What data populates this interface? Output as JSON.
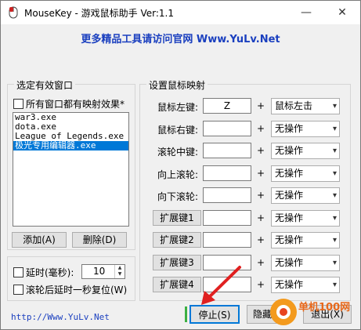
{
  "window": {
    "title": "MouseKey - 游戏鼠标助手 Ver:1.1",
    "minimize": "—",
    "close": "✕"
  },
  "banner": "更多精品工具请访问官网 Www.YuLv.Net",
  "left_group": {
    "title": "选定有效窗口",
    "all_windows_check": "所有窗口都有映射效果*",
    "items": [
      "war3.exe",
      "dota.exe",
      "League of Legends.exe",
      "极光专用编辑器.exe"
    ],
    "selected_index": 3,
    "add_button": "添加(A)",
    "delete_button": "删除(D)"
  },
  "delay_group": {
    "delay_check": "延时(毫秒):",
    "delay_value": "10",
    "reset_check": "滚轮后延时一秒复位(W)"
  },
  "right_group": {
    "title": "设置鼠标映射",
    "rows": [
      {
        "label": "鼠标左键:",
        "key": "Z",
        "action": "鼠标左击"
      },
      {
        "label": "鼠标右键:",
        "key": "",
        "action": "无操作"
      },
      {
        "label": "滚轮中键:",
        "key": "",
        "action": "无操作"
      },
      {
        "label": "向上滚轮:",
        "key": "",
        "action": "无操作"
      },
      {
        "label": "向下滚轮:",
        "key": "",
        "action": "无操作"
      },
      {
        "label": "扩展键1",
        "key": "",
        "action": "无操作"
      },
      {
        "label": "扩展键2",
        "key": "",
        "action": "无操作"
      },
      {
        "label": "扩展键3",
        "key": "",
        "action": "无操作"
      },
      {
        "label": "扩展键4",
        "key": "",
        "action": "无操作"
      }
    ],
    "plus": "+"
  },
  "footer": {
    "link": "http://Www.YuLv.Net",
    "stop_button": "停止(S)",
    "hide_button": "隐藏",
    "exit_button": "退出(X)"
  },
  "colors": {
    "accent": "#0078d7",
    "link": "#1a3fbf",
    "arrow": "#e02020"
  },
  "watermark": "单机100网 danji100.com"
}
